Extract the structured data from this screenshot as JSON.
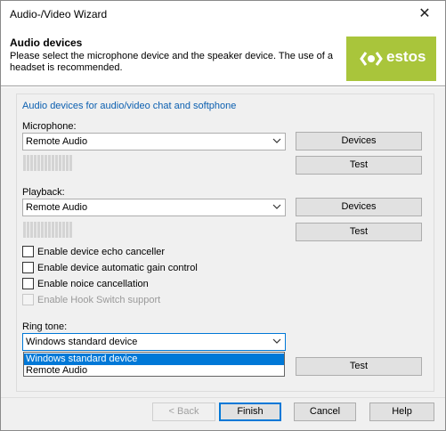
{
  "window": {
    "title": "Audio-/Video Wizard",
    "close_glyph": "✕"
  },
  "header": {
    "title": "Audio devices",
    "description": "Please select the microphone device and the speaker device. The use of a headset is recommended.",
    "logo_text": "estos",
    "logo_color": "#a9c53b"
  },
  "group": {
    "title": "Audio devices for audio/video chat and softphone",
    "title_color": "#0b5fb0"
  },
  "microphone": {
    "label": "Microphone:",
    "value": "Remote Audio",
    "devices_button": "Devices",
    "test_button": "Test",
    "level": 0
  },
  "playback": {
    "label": "Playback:",
    "value": "Remote Audio",
    "devices_button": "Devices",
    "test_button": "Test",
    "level": 0
  },
  "options": {
    "echo": {
      "label": "Enable device echo canceller",
      "checked": false
    },
    "agc": {
      "label": "Enable device automatic gain control",
      "checked": false
    },
    "noise": {
      "label": "Enable noice cancellation",
      "checked": false
    },
    "hook": {
      "label": "Enable Hook Switch support",
      "checked": false,
      "disabled": true
    }
  },
  "ringtone": {
    "label": "Ring tone:",
    "value": "Windows standard device",
    "options": [
      "Windows standard device",
      "Remote Audio"
    ],
    "selected_index": 0,
    "test_button": "Test"
  },
  "footer": {
    "back": "< Back",
    "finish": "Finish",
    "cancel": "Cancel",
    "help": "Help"
  },
  "accent_color": "#0078d7"
}
